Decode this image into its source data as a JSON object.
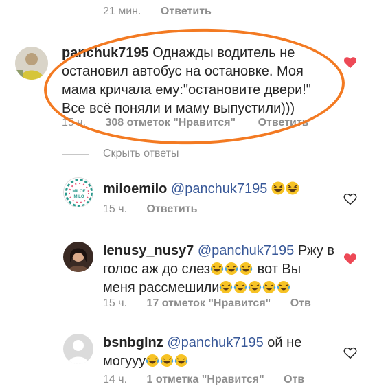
{
  "top": {
    "time": "21 мин.",
    "reply": "Ответить"
  },
  "main_comment": {
    "username": "panchuk7195",
    "line1": "Однажды водитель не",
    "line2": "остановил автобус на остановке.  Моя",
    "line3": "мама кричала ему:\"остановите двери!\"",
    "line4": "Все всё поняли и маму выпустили)))",
    "time": "15 ч.",
    "likes": "308 отметок \"Нравится\"",
    "reply": "Ответить",
    "liked": true
  },
  "hide_replies": "Скрыть ответы",
  "replies": [
    {
      "username": "miloemilo",
      "mention": "@panchuk7195",
      "emoji_count": 2,
      "time": "15 ч.",
      "reply": "Ответить",
      "liked": false,
      "avatar_text": "MILOE MILO"
    },
    {
      "username": "lenusy_nusy7",
      "mention": "@panchuk7195",
      "text1": "Ржу в",
      "text2": "голос аж до слез",
      "text2b": " вот Вы",
      "text3": "меня рассмешили",
      "time": "15 ч.",
      "likes": "17 отметок \"Нравится\"",
      "reply": "Отв",
      "liked": true
    },
    {
      "username": "bsnbglnz",
      "mention": "@panchuk7195",
      "text1": " ой не",
      "text2": "могууу",
      "time": "14 ч.",
      "likes": "1 отметка \"Нравится\"",
      "reply": "Отв",
      "liked": false
    }
  ],
  "colors": {
    "accent_mention": "#385898",
    "like_red": "#ed4956",
    "annotation_orange": "#f37a22",
    "meta_gray": "#8e8e8e"
  },
  "icons": [
    "heart-icon",
    "avatar",
    "laughing-emoji-icon",
    "tears-of-joy-emoji-icon"
  ]
}
